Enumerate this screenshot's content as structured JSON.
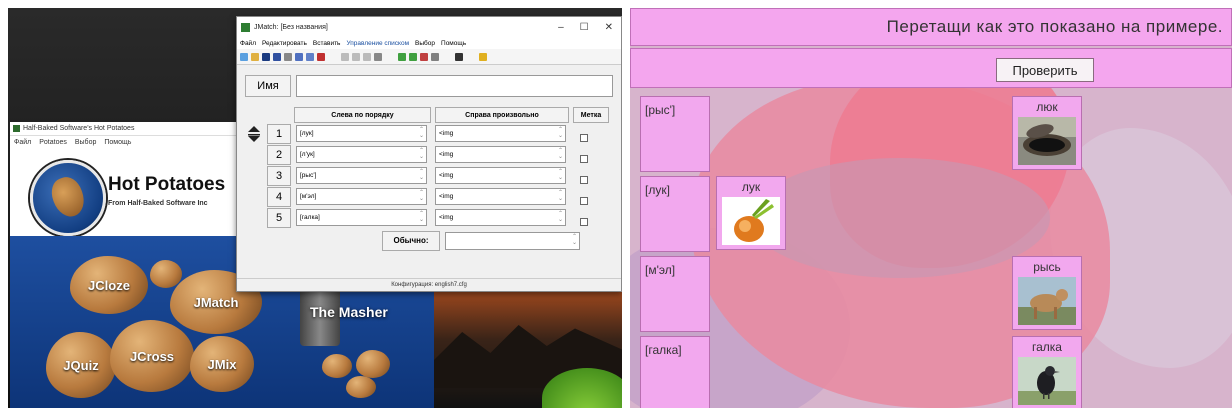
{
  "left": {
    "hot_potatoes": {
      "window_title": "Half-Baked Software's Hot Potatoes",
      "menu": [
        "Файл",
        "Potatoes",
        "Выбор",
        "Помощь"
      ],
      "brand": "Hot Potatoes",
      "tagline": "From Half-Baked Software Inc",
      "modules": [
        "JCloze",
        "JMatch",
        "JQuiz",
        "JCross",
        "JMix"
      ],
      "masher": "The Masher"
    },
    "jmatch": {
      "window_title": "JMatch: [Без названия]",
      "menu": [
        "Файл",
        "Редактировать",
        "Вставить",
        "Управление списком",
        "Выбор",
        "Помощь"
      ],
      "name_button": "Имя",
      "name_value": "",
      "col_left": "Слева по порядку",
      "col_right": "Справа произвольно",
      "col_mark": "Метка",
      "rows": [
        {
          "n": "1",
          "left": "[лук]",
          "right": "<img"
        },
        {
          "n": "2",
          "left": "[л'ук]",
          "right": "<img"
        },
        {
          "n": "3",
          "left": "[рыс']",
          "right": "<img"
        },
        {
          "n": "4",
          "left": "[м'эл]",
          "right": "<img"
        },
        {
          "n": "5",
          "left": "[галка]",
          "right": "<img"
        }
      ],
      "default_label": "Обычно:",
      "status": "Конфигурация: english7.cfg"
    }
  },
  "right": {
    "instruction": "Перетащи как это показано на примере.",
    "check_button": "Проверить",
    "labels": [
      "[рыс']",
      "[лук]",
      "[м'эл]",
      "[галка]"
    ],
    "cards": [
      {
        "word": "люк",
        "image": "manhole-image"
      },
      {
        "word": "лук",
        "image": "onion-image"
      },
      {
        "word": "рысь",
        "image": "lynx-image"
      },
      {
        "word": "галка",
        "image": "jackdaw-image"
      }
    ]
  }
}
